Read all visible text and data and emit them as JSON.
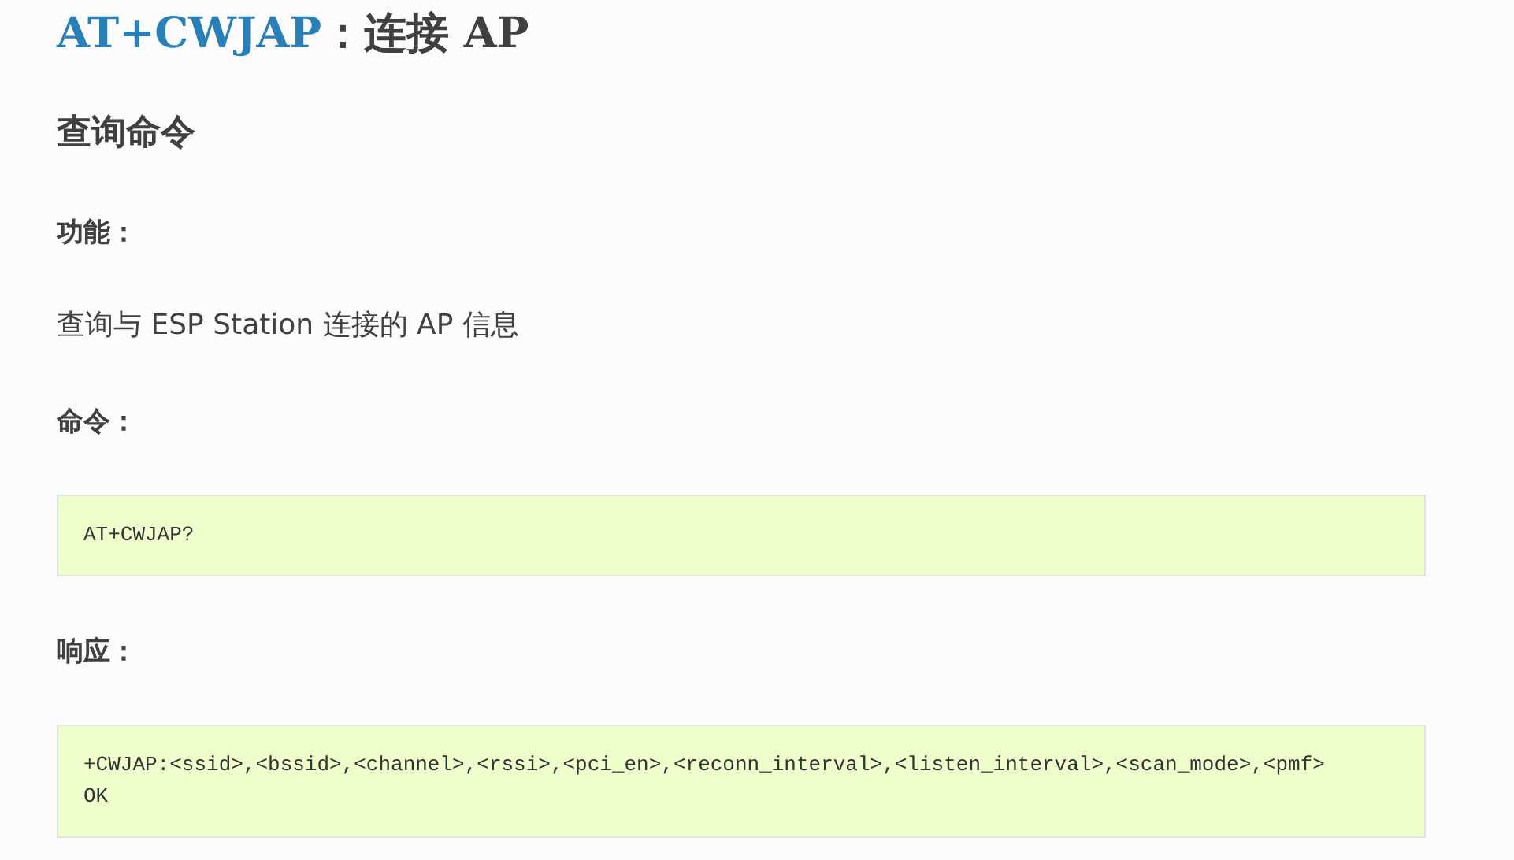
{
  "title": {
    "command": "AT+CWJAP",
    "text": "：连接 AP"
  },
  "section": "查询命令",
  "blocks": [
    {
      "kind": "label",
      "text": "功能："
    },
    {
      "kind": "paragraph",
      "text": "查询与 ESP Station 连接的 AP 信息"
    },
    {
      "kind": "label",
      "text": "命令："
    },
    {
      "kind": "code",
      "lines": [
        "AT+CWJAP?"
      ]
    },
    {
      "kind": "label",
      "text": "响应："
    },
    {
      "kind": "code",
      "lines": [
        "+CWJAP:<ssid>,<bssid>,<channel>,<rssi>,<pci_en>,<reconn_interval>,<listen_interval>,<scan_mode>,<pmf>",
        "OK"
      ]
    }
  ]
}
